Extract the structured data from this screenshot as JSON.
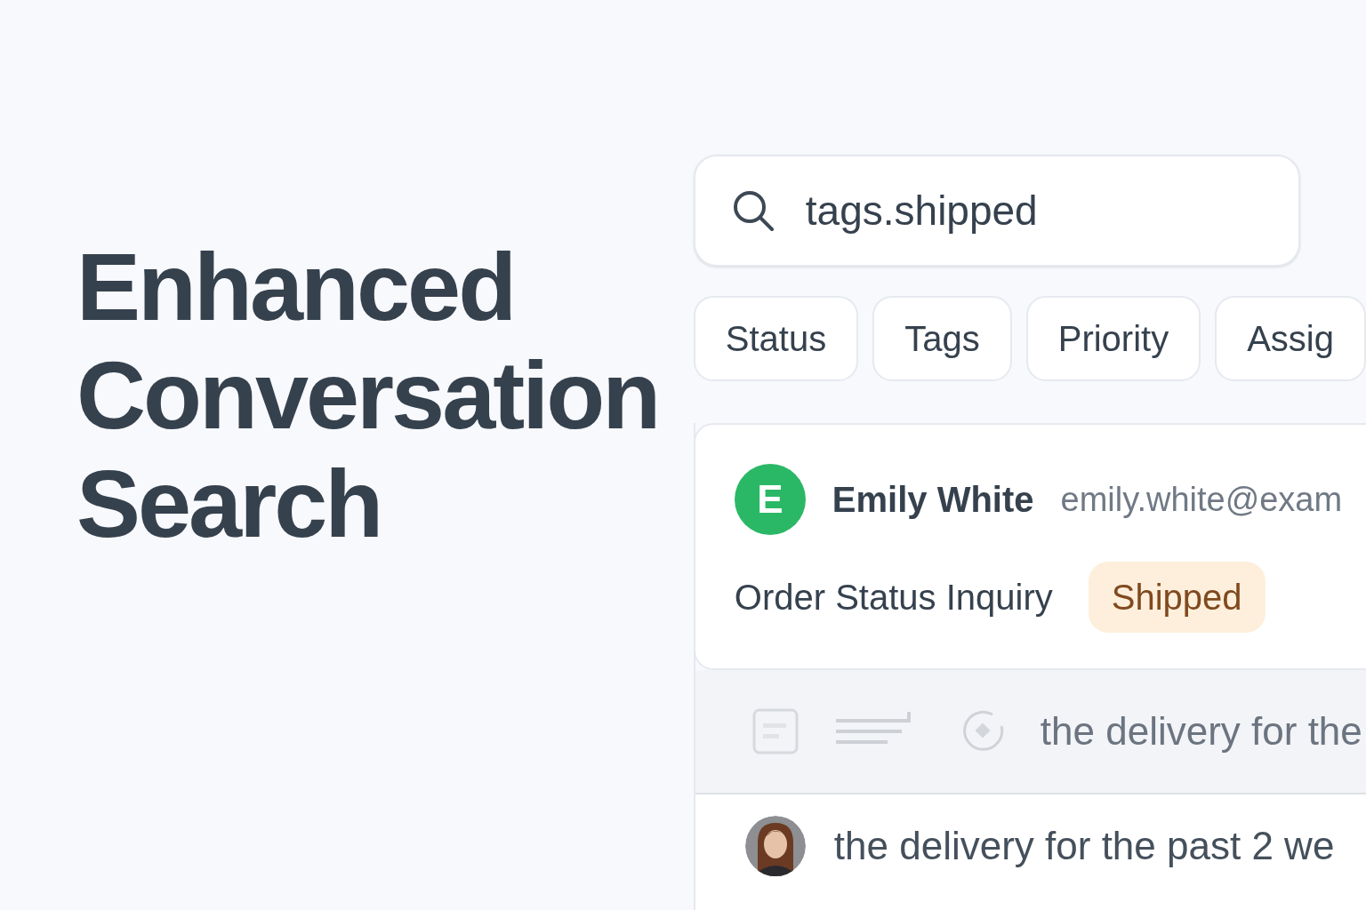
{
  "headline": [
    "Enhanced",
    "Conversation",
    "Search"
  ],
  "search": {
    "value": "tags.shipped"
  },
  "filters": [
    "Status",
    "Tags",
    "Priority",
    "Assig"
  ],
  "conversation": {
    "avatar_letter": "E",
    "name": "Emily White",
    "email": "emily.white@exam",
    "subject": "Order Status Inquiry",
    "tag": "Shipped"
  },
  "preview": {
    "text": "the delivery for the"
  },
  "message": {
    "text": "the delivery for the past 2 we"
  }
}
